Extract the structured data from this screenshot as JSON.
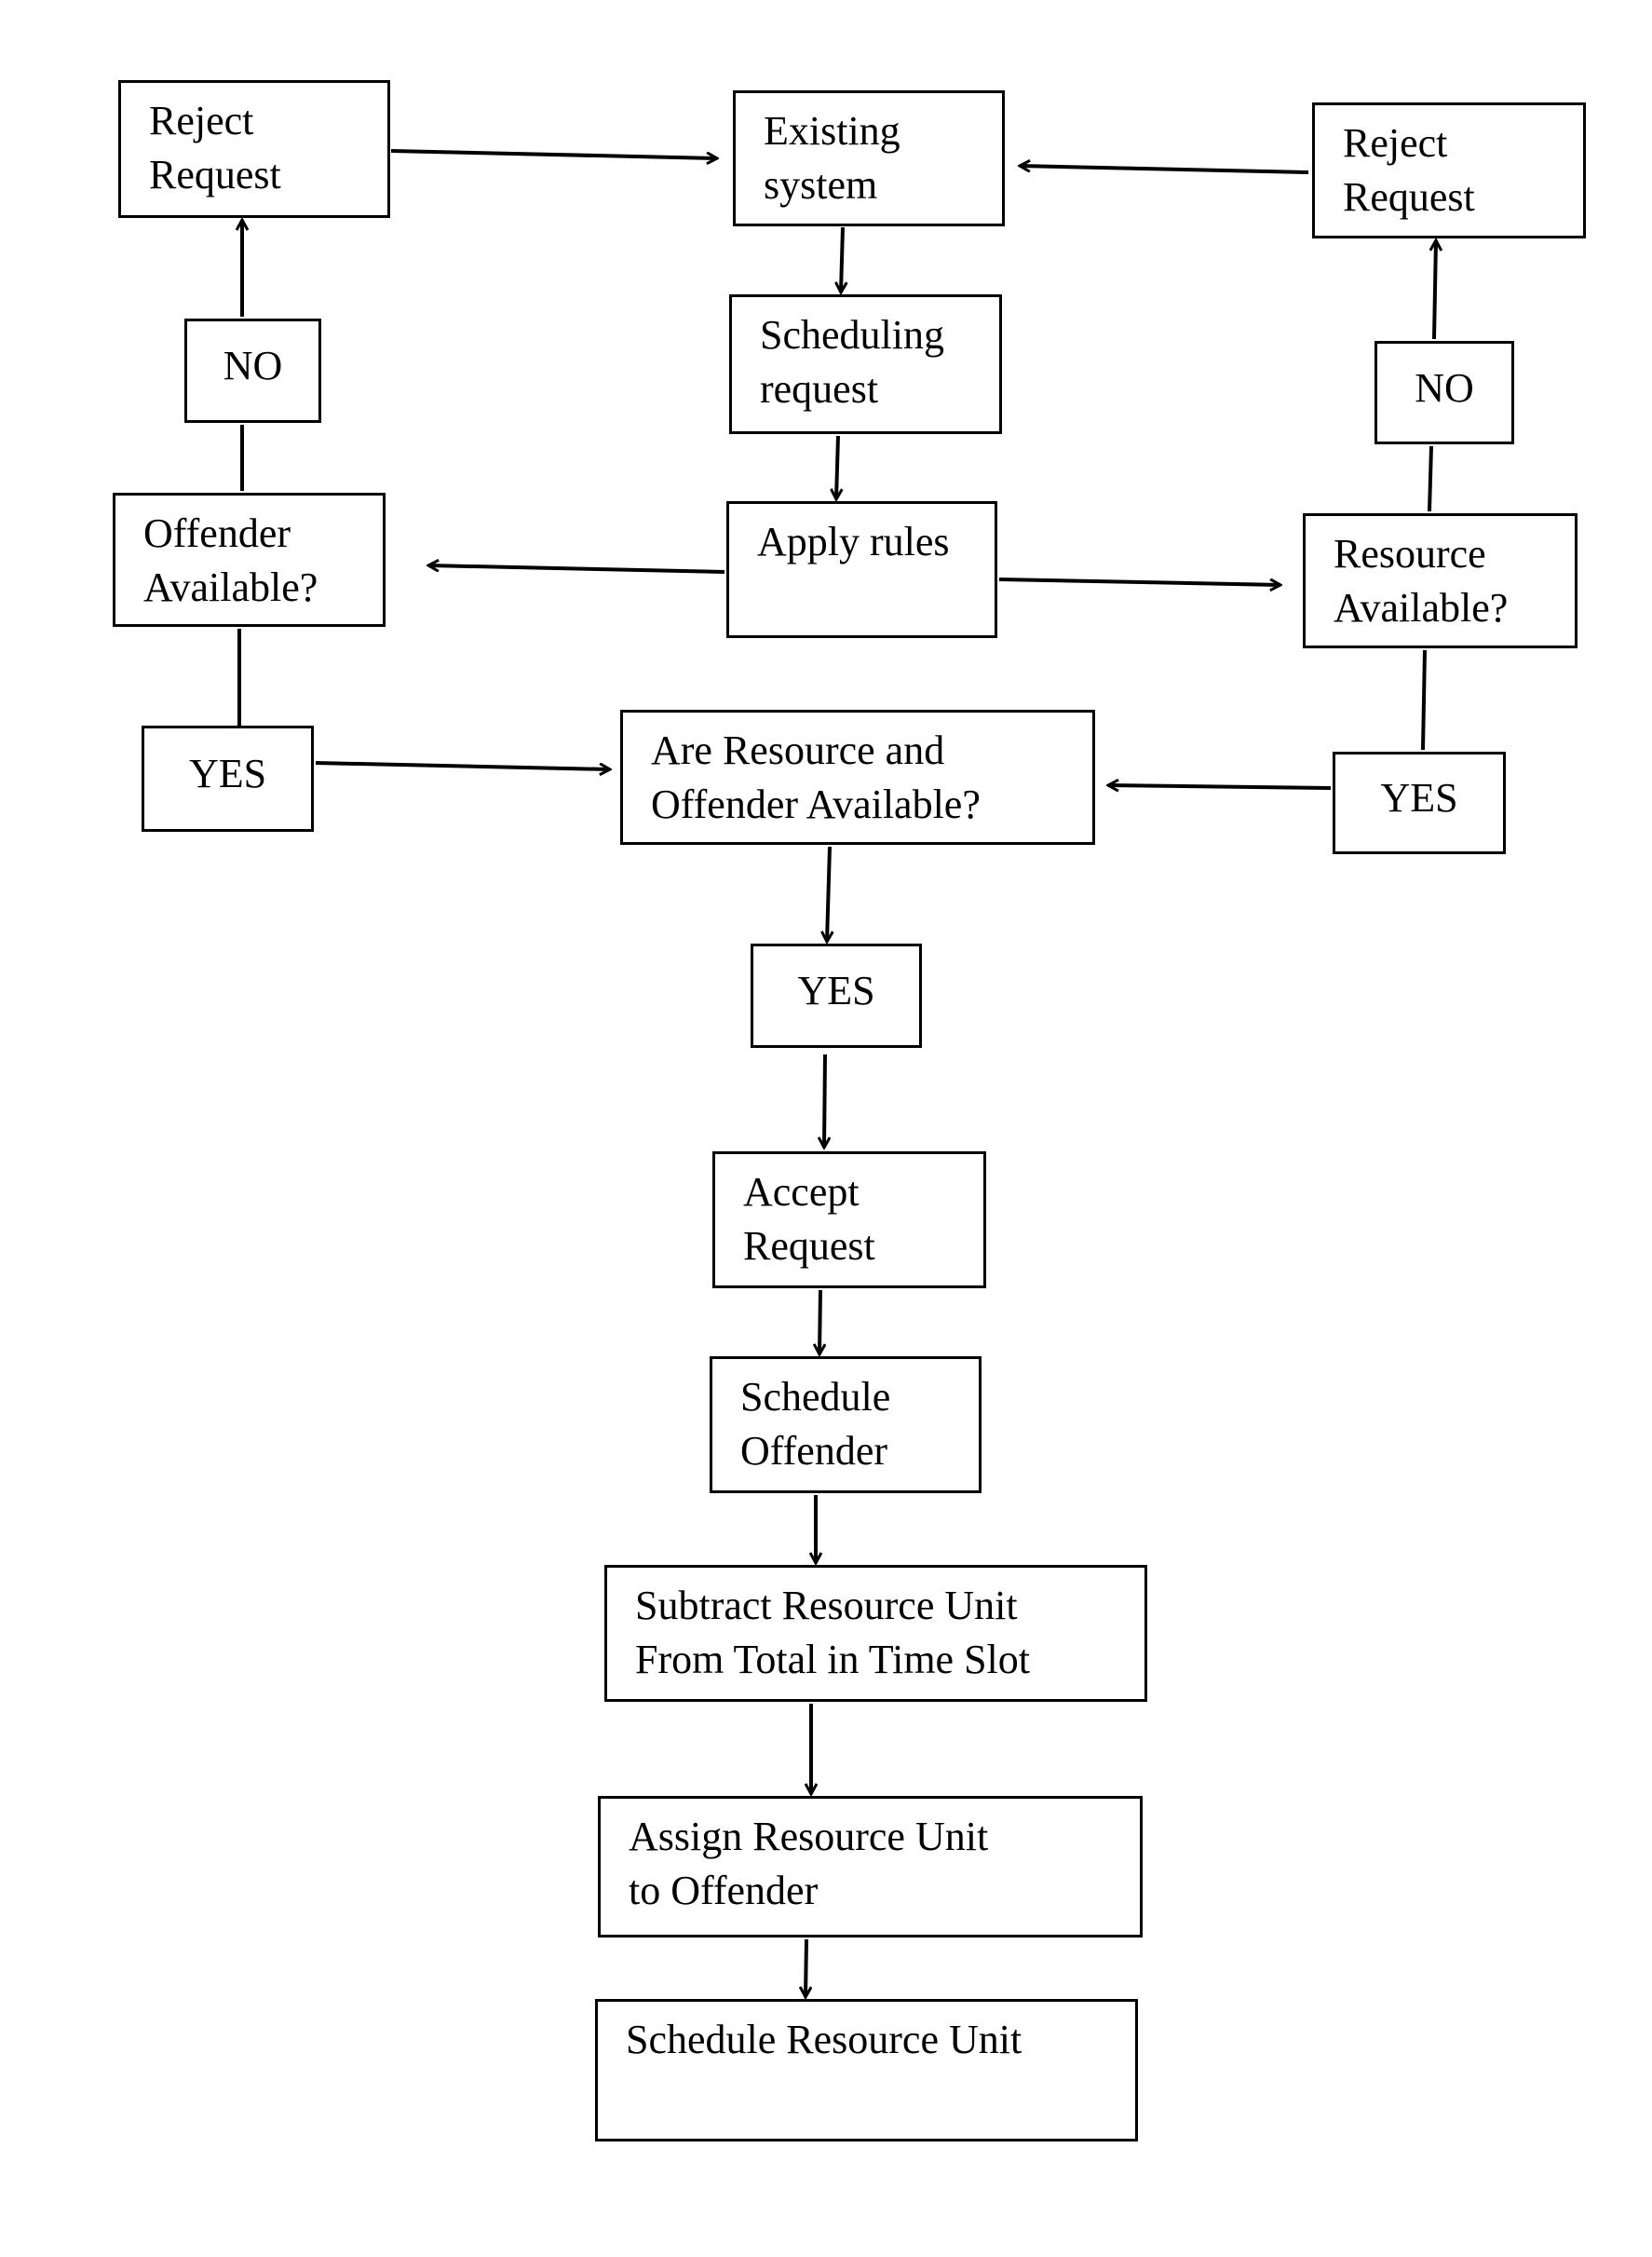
{
  "diagram": {
    "nodes": {
      "reject_left": "Reject\nRequest",
      "existing_system": "Existing\nsystem",
      "reject_right": "Reject\nRequest",
      "scheduling_request": "Scheduling\nrequest",
      "no_left": "NO",
      "no_right": "NO",
      "offender_available": "Offender\nAvailable?",
      "apply_rules": "Apply rules",
      "resource_available": "Resource\nAvailable?",
      "yes_left": "YES",
      "combined_check": "Are Resource  and\nOffender Available?",
      "yes_right": "YES",
      "yes_center": "YES",
      "accept_request": "Accept\nRequest",
      "schedule_offender": "Schedule\nOffender",
      "subtract_resource": "Subtract Resource Unit\nFrom Total in Time Slot",
      "assign_resource": "Assign Resource Unit\nto Offender",
      "schedule_resource": "Schedule Resource Unit"
    },
    "edges": [
      {
        "from": "reject_left",
        "to": "existing_system"
      },
      {
        "from": "reject_right",
        "to": "existing_system"
      },
      {
        "from": "existing_system",
        "to": "scheduling_request"
      },
      {
        "from": "scheduling_request",
        "to": "apply_rules"
      },
      {
        "from": "apply_rules",
        "to": "offender_available"
      },
      {
        "from": "apply_rules",
        "to": "resource_available"
      },
      {
        "from": "offender_available",
        "to": "no_left"
      },
      {
        "from": "no_left",
        "to": "reject_left"
      },
      {
        "from": "resource_available",
        "to": "no_right"
      },
      {
        "from": "no_right",
        "to": "reject_right"
      },
      {
        "from": "offender_available",
        "to": "yes_left"
      },
      {
        "from": "yes_left",
        "to": "combined_check"
      },
      {
        "from": "resource_available",
        "to": "yes_right"
      },
      {
        "from": "yes_right",
        "to": "combined_check"
      },
      {
        "from": "combined_check",
        "to": "yes_center"
      },
      {
        "from": "yes_center",
        "to": "accept_request"
      },
      {
        "from": "accept_request",
        "to": "schedule_offender"
      },
      {
        "from": "schedule_offender",
        "to": "subtract_resource"
      },
      {
        "from": "subtract_resource",
        "to": "assign_resource"
      },
      {
        "from": "assign_resource",
        "to": "schedule_resource"
      }
    ]
  }
}
